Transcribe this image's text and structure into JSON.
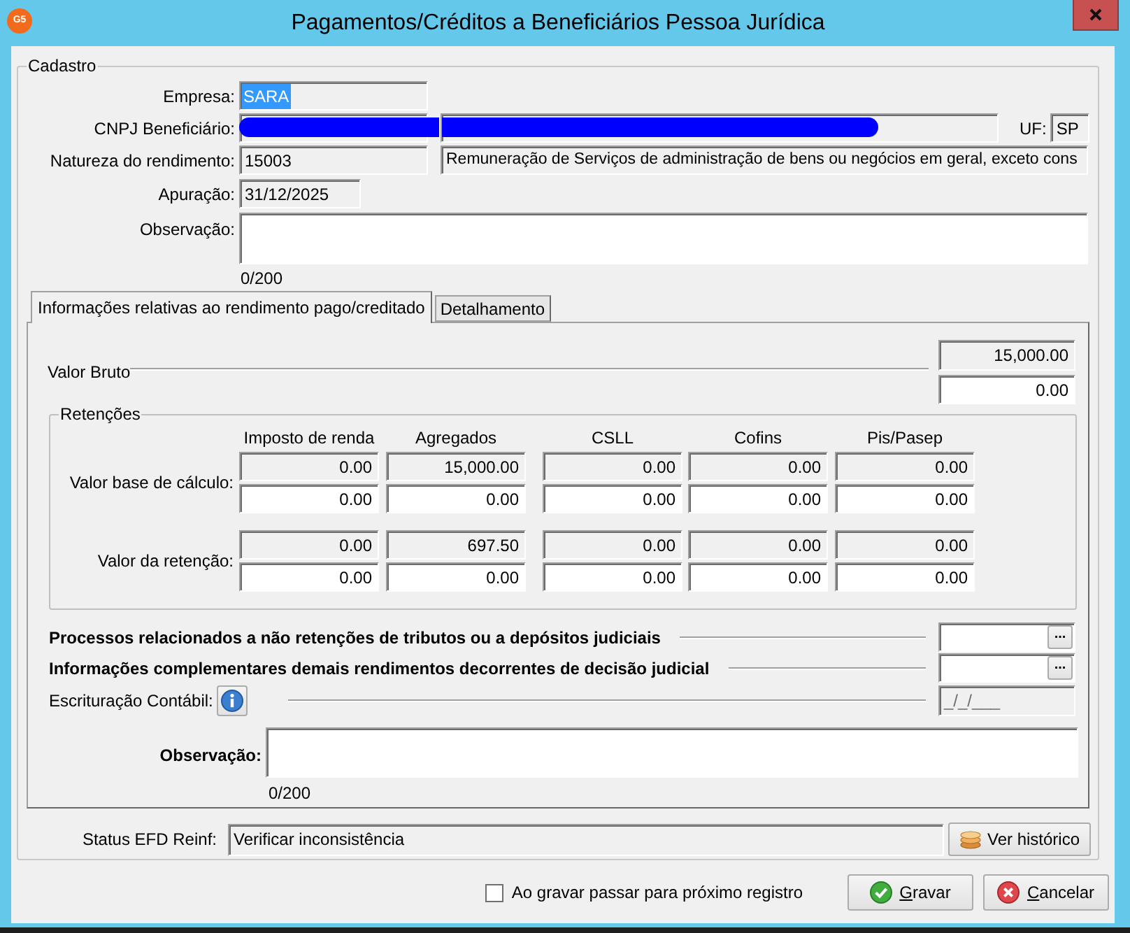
{
  "window": {
    "title": "Pagamentos/Créditos a Beneficiários Pessoa Jurídica",
    "app_badge": "G5"
  },
  "cadastro": {
    "legend": "Cadastro",
    "empresa": {
      "label": "Empresa:",
      "value": "SARA",
      "text_selected": true
    },
    "cnpj": {
      "label": "CNPJ Beneficiário:",
      "redacted": true
    },
    "uf": {
      "label": "UF:",
      "value": "SP"
    },
    "natureza": {
      "label": "Natureza do rendimento:",
      "code": "15003",
      "description": "Remuneração de Serviços de administração de bens ou negócios em geral, exceto cons"
    },
    "apuracao": {
      "label": "Apuração:",
      "value": "31/12/2025"
    },
    "observacao": {
      "label": "Observação:",
      "counter": "0/200"
    }
  },
  "tabs": [
    {
      "label": "Informações relativas ao rendimento pago/creditado",
      "selected": true
    },
    {
      "label": "Detalhamento",
      "selected": false
    }
  ],
  "rendimento": {
    "valor_bruto": {
      "label": "Valor Bruto",
      "readonly_value": "15,000.00",
      "value": "0.00"
    },
    "retencoes": {
      "legend": "Retenções",
      "columns": [
        "Imposto de renda",
        "Agregados",
        "CSLL",
        "Cofins",
        "Pis/Pasep"
      ],
      "rows": [
        {
          "label": "Valor base de cálculo:",
          "readonly_values": [
            "0.00",
            "15,000.00",
            "0.00",
            "0.00",
            "0.00"
          ],
          "values": [
            "0.00",
            "0.00",
            "0.00",
            "0.00",
            "0.00"
          ]
        },
        {
          "label": "Valor da retenção:",
          "readonly_values": [
            "0.00",
            "697.50",
            "0.00",
            "0.00",
            "0.00"
          ],
          "values": [
            "0.00",
            "0.00",
            "0.00",
            "0.00",
            "0.00"
          ]
        }
      ]
    },
    "lookups": [
      {
        "label": "Processos relacionados a não retenções de tributos ou a depósitos judiciais",
        "button": "..."
      },
      {
        "label": "Informações complementares demais rendimentos decorrentes de decisão judicial",
        "button": "..."
      }
    ],
    "escrituracao": {
      "label": "Escrituração Contábil:",
      "placeholder": "_/_/___",
      "disabled": true
    },
    "observacao": {
      "label": "Observação:",
      "counter": "0/200"
    }
  },
  "status": {
    "label": "Status EFD Reinf:",
    "value": "Verificar inconsistência",
    "button": "Ver histórico"
  },
  "footer": {
    "checkbox": {
      "label": "Ao gravar passar para próximo registro",
      "checked": false
    },
    "buttons": [
      {
        "kind": "save",
        "label": [
          {
            "text": "G",
            "underlined": true
          },
          {
            "text": "ravar",
            "underlined": false
          }
        ]
      },
      {
        "kind": "cancel",
        "label": [
          {
            "text": "C",
            "underlined": true
          },
          {
            "text": "ancelar",
            "underlined": false
          }
        ]
      }
    ]
  }
}
